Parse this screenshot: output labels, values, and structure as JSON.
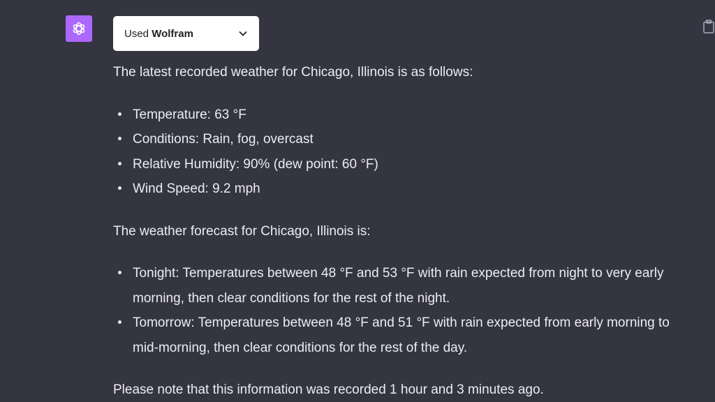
{
  "assistant": {
    "avatar_icon": "openai-logo-icon",
    "avatar_color": "#ab68ff"
  },
  "plugin": {
    "prefix": "Used ",
    "name": "Wolfram",
    "icon": "chevron-down-icon"
  },
  "toolbar": {
    "copy_icon": "clipboard-icon"
  },
  "message": {
    "intro": "The latest recorded weather for Chicago, Illinois is as follows:",
    "current": [
      "Temperature: 63 °F",
      "Conditions: Rain, fog, overcast",
      "Relative Humidity: 90% (dew point: 60 °F)",
      "Wind Speed: 9.2 mph"
    ],
    "forecast_intro": "The weather forecast for Chicago, Illinois is:",
    "forecast": [
      "Tonight: Temperatures between 48 °F and 53 °F with rain expected from night to very early morning, then clear conditions for the rest of the night.",
      "Tomorrow: Temperatures between 48 °F and 51 °F with rain expected from early morning to mid-morning, then clear conditions for the rest of the day."
    ],
    "note": "Please note that this information was recorded 1 hour and 3 minutes ago."
  }
}
